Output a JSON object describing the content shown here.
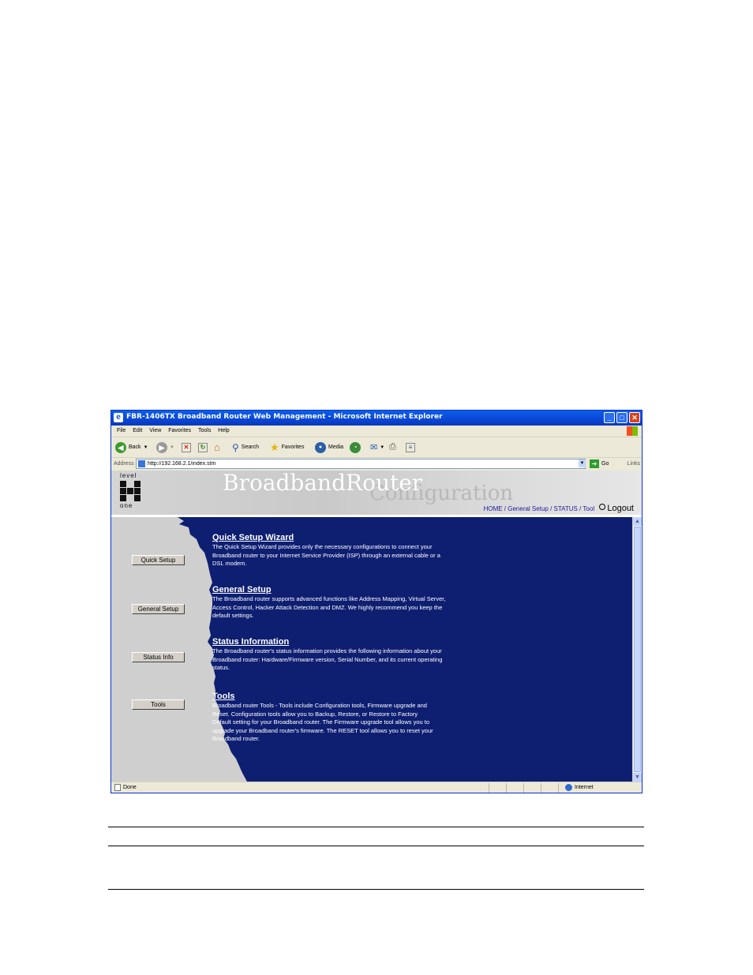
{
  "window": {
    "title": "FBR-1406TX Broadband Router Web Management - Microsoft Internet Explorer",
    "controls": {
      "minimize": "_",
      "maximize": "□",
      "close": "✕"
    }
  },
  "menu": [
    "File",
    "Edit",
    "View",
    "Favorites",
    "Tools",
    "Help"
  ],
  "toolbar": {
    "back": "Back",
    "search": "Search",
    "favorites": "Favorites",
    "media": "Media"
  },
  "address": {
    "label": "Address",
    "url": "http://192.168.2.1/index.stm",
    "go": "Go",
    "links": "Links"
  },
  "router": {
    "logo_top": "level",
    "logo_bottom": "one",
    "brand_main": "BroadbandRouter",
    "brand_sub": "Configuration",
    "nav": [
      "HOME",
      "General Setup",
      "STATUS",
      "Tool"
    ],
    "logout": "Logout",
    "buttons": [
      "Quick Setup",
      "General Setup",
      "Status Info",
      "Tools"
    ],
    "sections": [
      {
        "title": "Quick Setup Wizard",
        "text": "The Quick Setup Wizard provides only the necessary configurations to connect your Broadband router to your Internet Service Provider (ISP) through an external cable or a DSL modem."
      },
      {
        "title": "General Setup",
        "text": "The Broadband router supports advanced functions like Address Mapping, Virtual Server, Access Control, Hacker Attack Detection and DMZ. We highly recommend you keep the default settings."
      },
      {
        "title": "Status Information",
        "text": "The Broadband router's status information provides the following information about your Broadband router: Hardware/Firmware version, Serial Number, and its current operating status."
      },
      {
        "title": "Tools",
        "text": "Broadband router Tools - Tools include Configuration tools, Firmware upgrade and Reset. Configuration tools allow you to Backup, Restore, or Restore to Factory Default setting for your Broadband router. The Firmware upgrade tool allows you to upgrade your Broadband router's firmware. The RESET tool allows you to reset your Broadband router."
      }
    ]
  },
  "status": {
    "left": "Done",
    "zone": "Internet"
  },
  "colors": {
    "panel_blue": "#0e1f72",
    "titlebar": "#0a46d6"
  }
}
